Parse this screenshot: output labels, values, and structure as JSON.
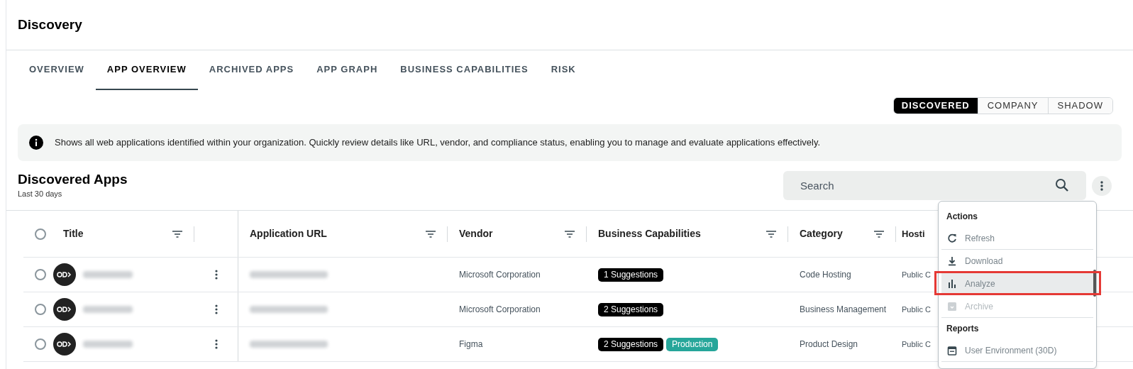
{
  "page_title": "Discovery",
  "tabs": [
    {
      "label": "OVERVIEW",
      "selected": false
    },
    {
      "label": "APP OVERVIEW",
      "selected": true
    },
    {
      "label": "ARCHIVED APPS",
      "selected": false
    },
    {
      "label": "APP GRAPH",
      "selected": false
    },
    {
      "label": "BUSINESS CAPABILITIES",
      "selected": false
    },
    {
      "label": "RISK",
      "selected": false
    }
  ],
  "segments": [
    {
      "label": "DISCOVERED",
      "selected": true
    },
    {
      "label": "COMPANY",
      "selected": false
    },
    {
      "label": "SHADOW",
      "selected": false
    }
  ],
  "info_banner": "Shows all web applications identified within your organization. Quickly review details like URL, vendor, and compliance status, enabling you to manage and evaluate applications effectively.",
  "section": {
    "title": "Discovered Apps",
    "subtitle": "Last 30 days"
  },
  "search": {
    "placeholder": "Search"
  },
  "table": {
    "select_all_selected": false,
    "columns": [
      "Title",
      "Application URL",
      "Vendor",
      "Business Capabilities",
      "Category",
      "Hosti"
    ],
    "rows": [
      {
        "selected": false,
        "vendor": "Microsoft Corporation",
        "tags": [
          {
            "label": "1 Suggestions",
            "kind": "suggestion"
          }
        ],
        "category": "Code Hosting",
        "hosting": "Public C"
      },
      {
        "selected": false,
        "vendor": "Microsoft Corporation",
        "tags": [
          {
            "label": "2 Suggestions",
            "kind": "suggestion"
          }
        ],
        "category": "Business Management",
        "hosting": "Public C"
      },
      {
        "selected": false,
        "vendor": "Figma",
        "tags": [
          {
            "label": "2 Suggestions",
            "kind": "suggestion"
          },
          {
            "label": "Production",
            "kind": "environment"
          }
        ],
        "category": "Product Design",
        "hosting": "Public C"
      }
    ]
  },
  "menu": {
    "sections": [
      {
        "header": "Actions",
        "items": [
          {
            "label": "Refresh",
            "kind": "refresh",
            "highlighted": false,
            "disabled": false
          },
          {
            "label": "Download",
            "kind": "download",
            "highlighted": false,
            "disabled": false
          },
          {
            "label": "Analyze",
            "kind": "chart",
            "highlighted": true,
            "disabled": false
          },
          {
            "label": "Archive",
            "kind": "archive",
            "highlighted": false,
            "disabled": true
          }
        ]
      },
      {
        "header": "Reports",
        "items": [
          {
            "label": "User Environment (30D)",
            "kind": "calendar",
            "highlighted": false,
            "disabled": false
          }
        ]
      }
    ]
  }
}
